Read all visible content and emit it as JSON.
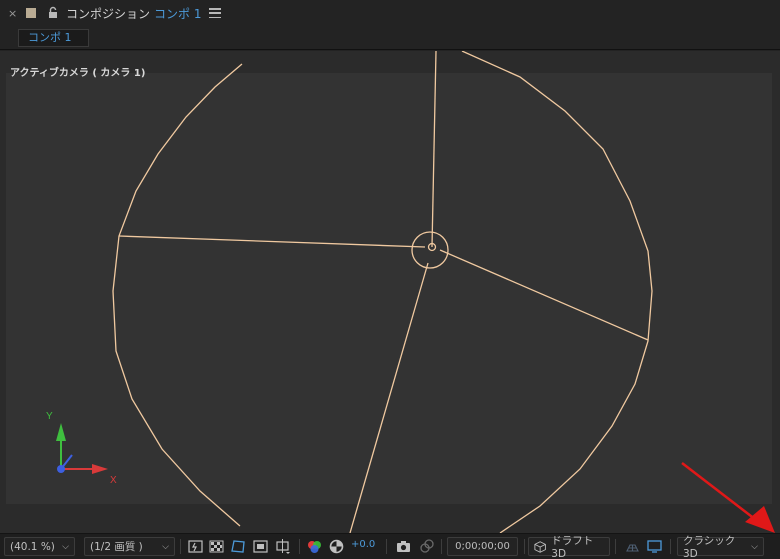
{
  "panel": {
    "close_glyph": "×",
    "title_prefix": "コンポジション",
    "comp_name": "コンポ 1",
    "swatch_color": "#b9ab93"
  },
  "tabs": [
    {
      "label": "コンポ 1"
    }
  ],
  "viewer": {
    "view_label": "アクティブカメラ ( カメラ 1)",
    "axis": {
      "x_label": "X",
      "y_label": "Y"
    },
    "wire_color": "#f0c9a0"
  },
  "toolbar": {
    "zoom": "(40.1 %)",
    "resolution": "(1/2 画質 )",
    "exposure": "+0.0",
    "timecode": "0;00;00;00",
    "draft3d": "ドラフト 3D",
    "renderer": "クラシック 3D",
    "accent_color": "#4c9ad9"
  }
}
